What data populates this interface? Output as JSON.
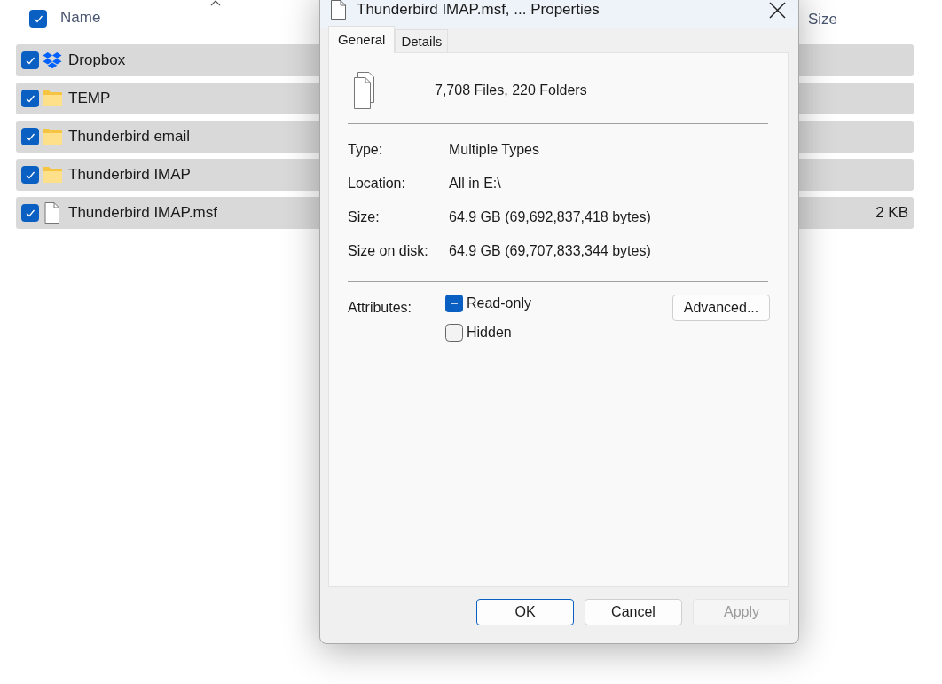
{
  "file_list": {
    "header": {
      "all_checked": true,
      "columns": [
        {
          "label": "Name"
        },
        {
          "label": "Size"
        }
      ]
    },
    "rows": [
      {
        "name": "Dropbox",
        "kind": "dropbox",
        "checked": true
      },
      {
        "name": "TEMP",
        "kind": "folder",
        "checked": true
      },
      {
        "name": "Thunderbird email",
        "kind": "folder",
        "checked": true
      },
      {
        "name": "Thunderbird IMAP",
        "kind": "folder",
        "checked": true
      },
      {
        "name": "Thunderbird IMAP.msf",
        "kind": "file",
        "checked": true,
        "size": "2 KB"
      }
    ]
  },
  "dialog": {
    "title": "Thunderbird IMAP.msf, ... Properties",
    "tabs": [
      {
        "label": "General",
        "selected": true
      },
      {
        "label": "Details",
        "selected": false
      }
    ],
    "summary": "7,708 Files, 220 Folders",
    "properties": [
      {
        "label": "Type:",
        "value": "Multiple Types"
      },
      {
        "label": "Location:",
        "value": "All in E:\\"
      },
      {
        "label": "Size:",
        "value": "64.9 GB (69,692,837,418 bytes)"
      },
      {
        "label": "Size on disk:",
        "value": "64.9 GB (69,707,833,344 bytes)"
      }
    ],
    "attributes": {
      "label": "Attributes:",
      "options": [
        {
          "label": "Read-only",
          "checked": false,
          "mixed": true
        },
        {
          "label": "Hidden",
          "checked": false,
          "mixed": false
        }
      ],
      "button": "Advanced..."
    },
    "buttons": [
      {
        "label": "OK",
        "default": true,
        "disabled": false
      },
      {
        "label": "Cancel",
        "default": false,
        "disabled": false
      },
      {
        "label": "Apply",
        "default": false,
        "disabled": true
      }
    ]
  }
}
